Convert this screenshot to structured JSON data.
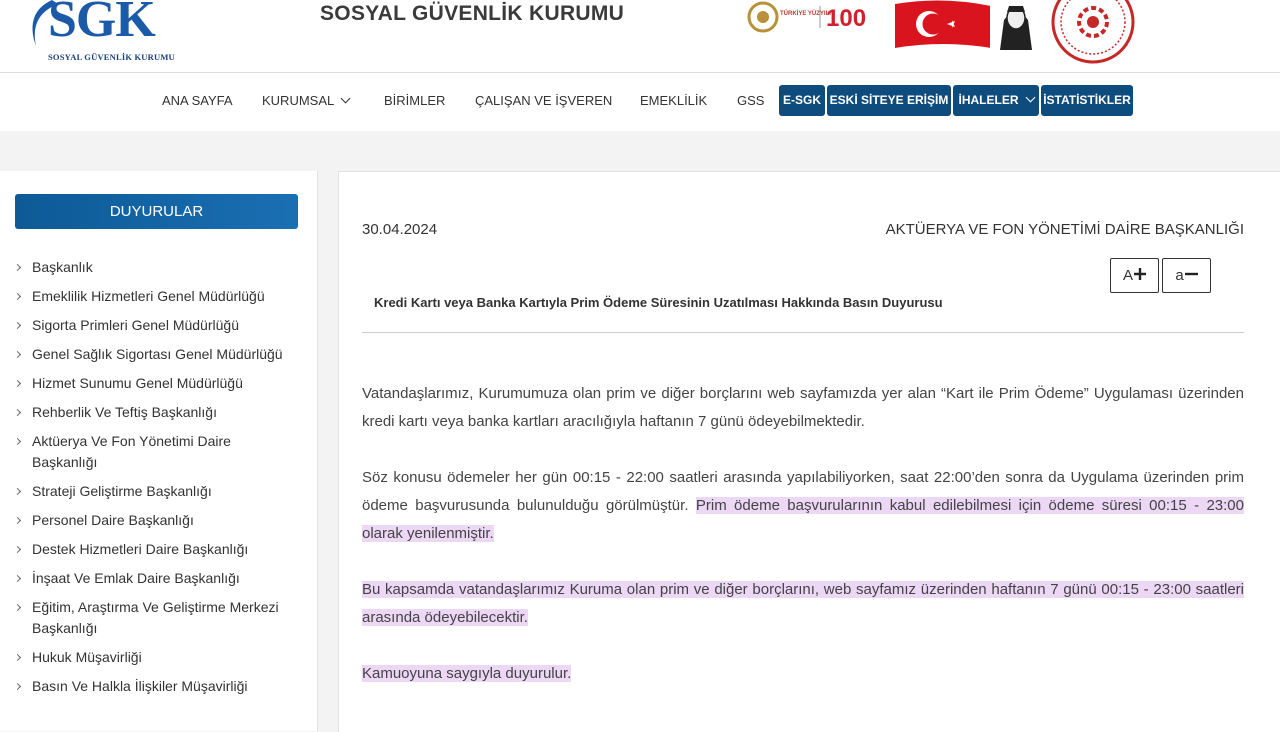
{
  "header": {
    "logo_text": "SGK",
    "logo_subtitle": "SOSYAL GÜVENLİK KURUMU",
    "site_title": "SOSYAL GÜVENLİK KURUMU",
    "badge_small": "TÜRKİYE YÜZYILI",
    "badge_number": "100"
  },
  "nav": {
    "items": [
      "ANA SAYFA",
      "KURUMSAL",
      "BİRİMLER",
      "ÇALIŞAN VE İŞVEREN",
      "EMEKLİLİK",
      "GSS"
    ],
    "buttons": [
      "E-SGK",
      "ESKİ SİTEYE ERİŞİM",
      "İHALELER",
      "İSTATİSTİKLER"
    ]
  },
  "sidebar": {
    "title": "DUYURULAR",
    "items": [
      "Başkanlık",
      "Emeklilik Hizmetleri Genel Müdürlüğü",
      "Sigorta Primleri Genel Müdürlüğü",
      "Genel Sağlık Sigortası Genel Müdürlüğü",
      "Hizmet Sunumu Genel Müdürlüğü",
      "Rehberlik Ve Teftiş Başkanlığı",
      "Aktüerya Ve Fon Yönetimi Daire Başkanlığı",
      "Strateji Geliştirme Başkanlığı",
      "Personel Daire Başkanlığı",
      "Destek Hizmetleri Daire Başkanlığı",
      "İnşaat Ve Emlak Daire Başkanlığı",
      "Eğitim, Araştırma Ve Geliştirme Merkezi Başkanlığı",
      "Hukuk Müşavirliği",
      "Basın Ve Halkla İlişkiler Müşavirliği"
    ]
  },
  "article": {
    "date": "30.04.2024",
    "department": "AKTÜERYA VE FON YÖNETİMİ DAİRE BAŞKANLIĞI",
    "font_increase": "A",
    "font_decrease": "a",
    "title": "Kredi Kartı veya Banka Kartıyla Prim Ödeme Süresinin Uzatılması Hakkında Basın Duyurusu",
    "p1": "Vatandaşlarımız, Kurumumuza olan prim ve diğer borçlarını web sayfamızda yer alan “Kart ile Prim Ödeme” Uygulaması üzerinden kredi kartı veya banka kartları aracılığıyla haftanın 7 günü ödeyebilmektedir.",
    "p2a": "Söz konusu ödemeler her gün 00:15 - 22:00 saatleri arasında yapılabiliyorken, saat 22:00’den sonra da Uygulama üzerinden prim ödeme başvurusunda bulunulduğu görülmüştür. ",
    "p2b": "Prim ödeme başvurularının kabul edilebilmesi için ödeme süresi 00:15 - 23:00 olarak yenilenmiştir.",
    "p3": "Bu kapsamda vatandaşlarımız Kuruma olan prim ve diğer borçlarını, web sayfamız üzerinden haftanın 7 günü 00:15 - 23:00 saatleri arasında ödeyebilecektir.",
    "p4": "Kamuoyuna saygıyla duyurulur."
  }
}
